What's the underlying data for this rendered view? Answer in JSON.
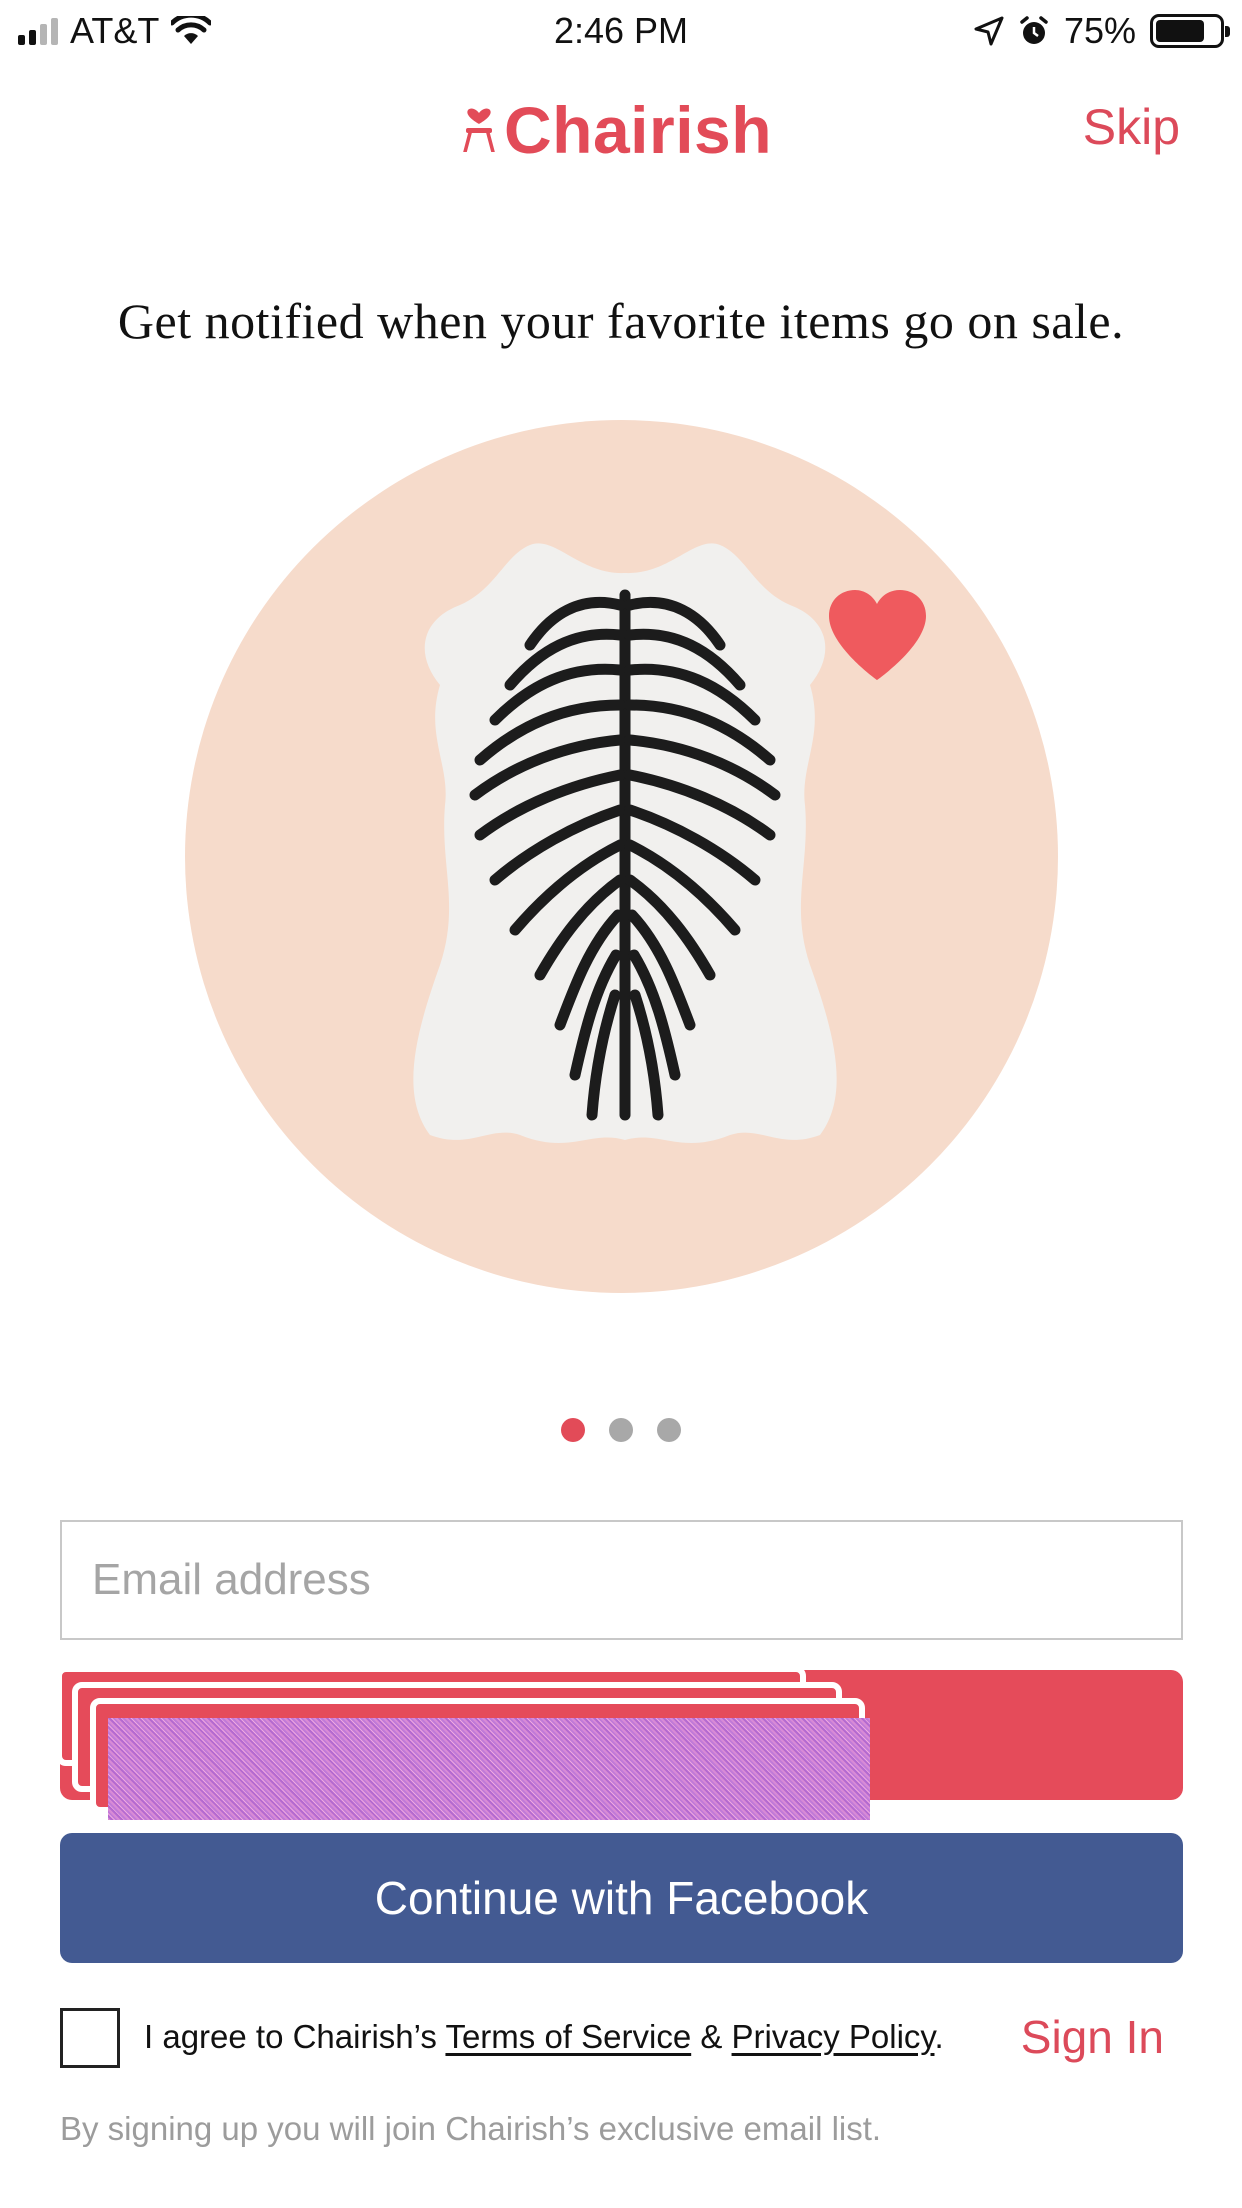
{
  "status_bar": {
    "carrier": "AT&T",
    "time": "2:46 PM",
    "battery_percent": "75%",
    "battery_level": 0.75,
    "icons": [
      "signal-icon",
      "wifi-icon",
      "location-icon",
      "alarm-icon",
      "battery-icon"
    ]
  },
  "header": {
    "logo_text": "Chairish",
    "skip_label": "Skip"
  },
  "onboarding": {
    "headline": "Get notified when your favorite items go on sale.",
    "illustration": {
      "background": "#f6dbcb",
      "subject": "zebra-hide-rug",
      "accent": "heart-icon"
    },
    "pager": {
      "total": 3,
      "active_index": 0
    }
  },
  "form": {
    "email_placeholder": "Email address",
    "email_value": "",
    "signup_label": "",
    "facebook_label": "Continue with Facebook"
  },
  "terms": {
    "prefix": "I agree to Chairish’s ",
    "terms_link": "Terms of Service",
    "joiner": " & ",
    "privacy_link": "Privacy Policy",
    "suffix": ".",
    "checked": false
  },
  "signin_label": "Sign In",
  "footnote": "By signing up you will join Chairish’s exclusive email list.",
  "colors": {
    "brand": "#e24b58",
    "facebook": "#435a92",
    "pager_inactive": "#a8a8a8",
    "muted_text": "#9c9c9c"
  }
}
